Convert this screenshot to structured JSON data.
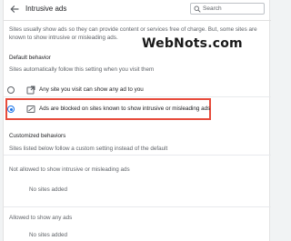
{
  "header": {
    "title": "Intrusive ads",
    "search_placeholder": "Search"
  },
  "description": "Sites usually show ads so they can provide content or services free of charge. But, some sites are known to show intrusive or misleading ads.",
  "watermark": "WebNots.com",
  "default_behavior": {
    "title": "Default behavior",
    "subtitle": "Sites automatically follow this setting when you visit them",
    "options": [
      {
        "label": "Any site you visit can show any ad to you",
        "selected": false,
        "icon": "external-link-icon"
      },
      {
        "label": "Ads are blocked on sites known to show intrusive or misleading ads",
        "selected": true,
        "icon": "blocked-ad-icon"
      }
    ]
  },
  "customized_behaviors": {
    "title": "Customized behaviors",
    "subtitle": "Sites listed below follow a custom setting instead of the default",
    "not_allowed": {
      "title": "Not allowed to show intrusive or misleading ads",
      "empty": "No sites added"
    },
    "allowed": {
      "title": "Allowed to show any ads",
      "empty": "No sites added"
    }
  },
  "colors": {
    "accent": "#1a73e8",
    "highlight": "#e74c3c"
  }
}
